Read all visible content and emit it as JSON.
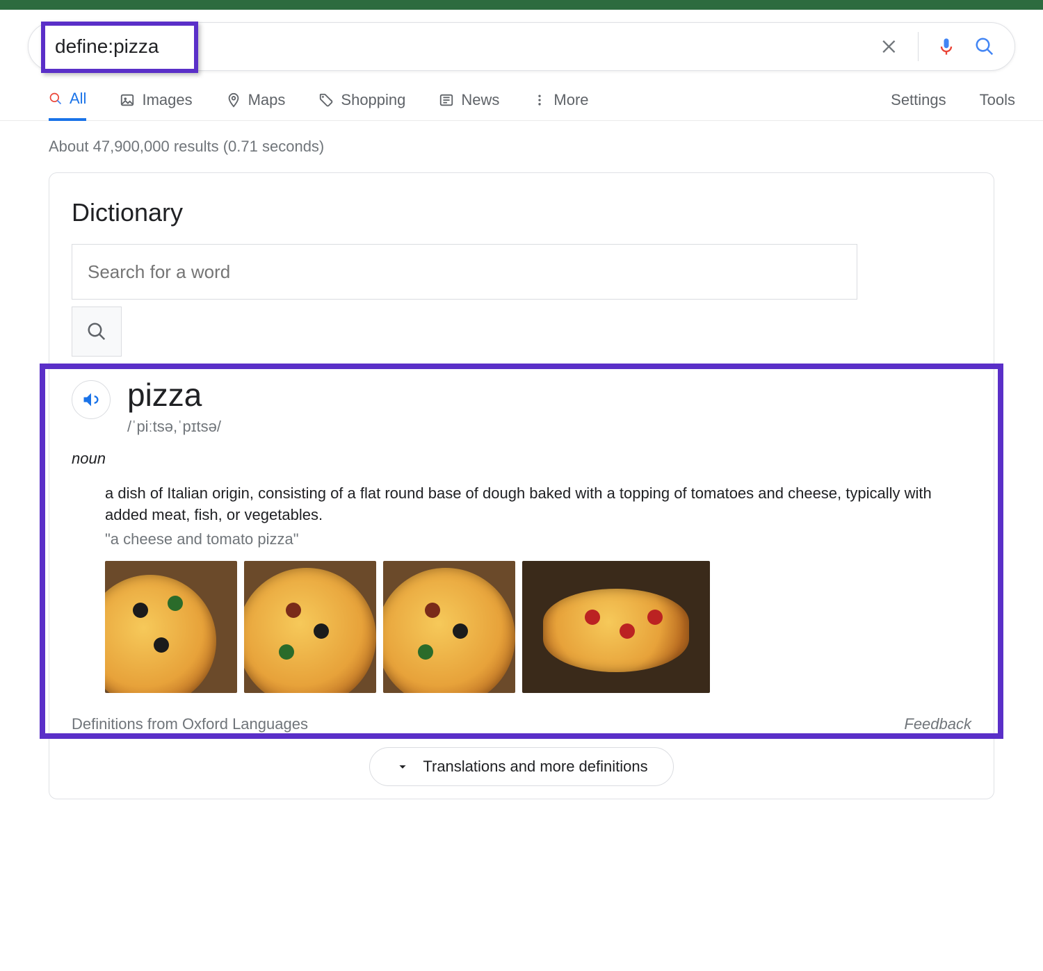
{
  "search": {
    "query": "define:pizza"
  },
  "tabs": {
    "all": "All",
    "images": "Images",
    "maps": "Maps",
    "shopping": "Shopping",
    "news": "News",
    "more": "More"
  },
  "tools": {
    "settings": "Settings",
    "tools": "Tools"
  },
  "results_info": "About 47,900,000 results (0.71 seconds)",
  "dict": {
    "title": "Dictionary",
    "placeholder": "Search for a word",
    "word": "pizza",
    "phonetic": "/ˈpiːtsə,ˈpɪtsə/",
    "part_of_speech": "noun",
    "definition": "a dish of Italian origin, consisting of a flat round base of dough baked with a topping of tomatoes and cheese, typically with added meat, fish, or vegetables.",
    "example": "\"a cheese and tomato pizza\"",
    "source": "Definitions from Oxford Languages",
    "feedback": "Feedback",
    "more": "Translations and more definitions"
  }
}
